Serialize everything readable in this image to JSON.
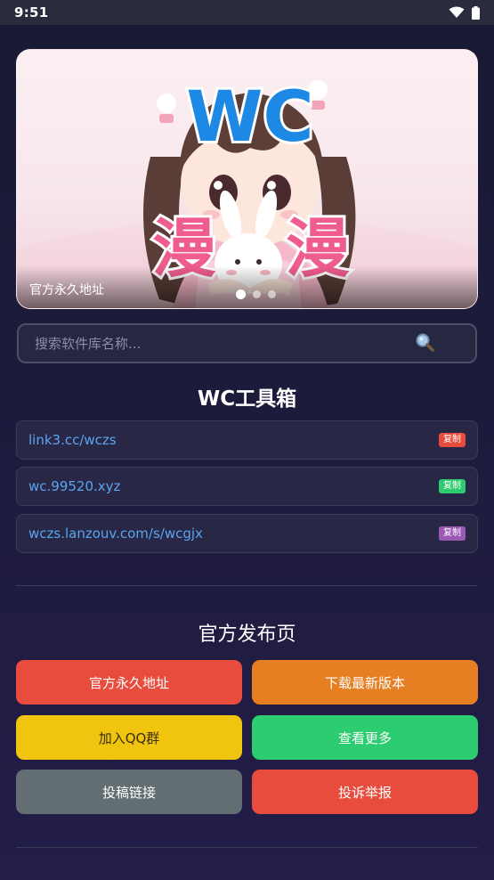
{
  "status_bar": {
    "time": "9:51",
    "icons": [
      "wifi-icon",
      "battery-icon"
    ]
  },
  "banner": {
    "caption": "官方永久地址",
    "artwork_text": {
      "top": "WC",
      "left": "漫",
      "right": "漫"
    },
    "dots": 3,
    "active_dot": 1
  },
  "search": {
    "placeholder": "搜索软件库名称...",
    "icon": "search-icon"
  },
  "toolbox": {
    "title": "WC工具箱",
    "links": [
      {
        "url": "link3.cc/wczs",
        "badge": "复制",
        "badge_color": "#e74c3c"
      },
      {
        "url": "wc.99520.xyz",
        "badge": "复制",
        "badge_color": "#2ecc71"
      },
      {
        "url": "wczs.lanzouv.com/s/wcgjx",
        "badge": "复制",
        "badge_color": "#9b59b6"
      }
    ]
  },
  "release": {
    "title": "官方发布页",
    "buttons": [
      {
        "label": "官方永久地址",
        "color": "#e74c3c"
      },
      {
        "label": "下载最新版本",
        "color": "#e67e22"
      },
      {
        "label": "加入QQ群",
        "color": "#f1c40f"
      },
      {
        "label": "查看更多",
        "color": "#2ecc71"
      },
      {
        "label": "投稿链接",
        "color": "#636e72"
      },
      {
        "label": "投诉举报",
        "color": "#e74c3c"
      }
    ]
  },
  "colors": {
    "background": "#1c1b3b",
    "link_text": "#5aa4f0",
    "card": "#282846"
  }
}
